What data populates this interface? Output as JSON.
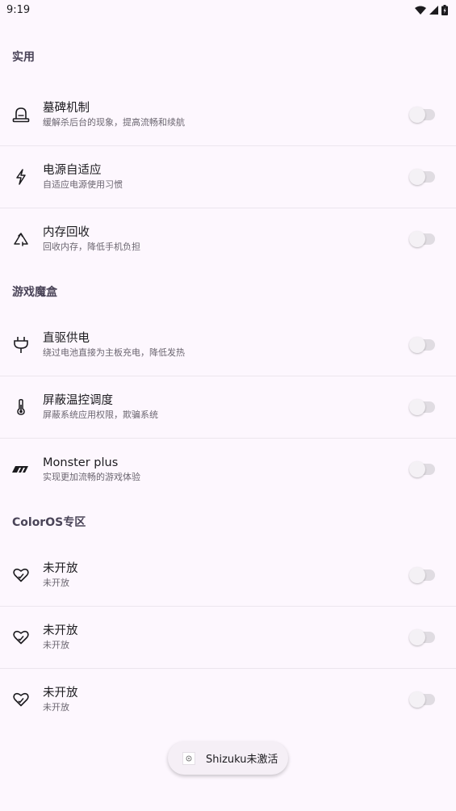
{
  "status_bar": {
    "time": "9:19"
  },
  "sections": [
    {
      "title": "实用",
      "items": [
        {
          "icon": "tombstone-icon",
          "title": "墓碑机制",
          "subtitle": "缓解杀后台的现象，提高流畅和续航",
          "enabled": false
        },
        {
          "icon": "lightning-icon",
          "title": "电源自适应",
          "subtitle": "自适应电源使用习惯",
          "enabled": false
        },
        {
          "icon": "recycle-icon",
          "title": "内存回收",
          "subtitle": "回收内存，降低手机负担",
          "enabled": false
        }
      ]
    },
    {
      "title": "游戏魔盒",
      "items": [
        {
          "icon": "plug-icon",
          "title": "直驱供电",
          "subtitle": "绕过电池直接为主板充电，降低发热",
          "enabled": false
        },
        {
          "icon": "thermometer-icon",
          "title": "屏蔽温控调度",
          "subtitle": "屏蔽系统应用权限，欺骗系统",
          "enabled": false
        },
        {
          "icon": "monster-logo-icon",
          "title": "Monster plus",
          "subtitle": "实现更加流畅的游戏体验",
          "enabled": false
        }
      ]
    },
    {
      "title": "ColorOS专区",
      "items": [
        {
          "icon": "heart-check-icon",
          "title": "未开放",
          "subtitle": "未开放",
          "enabled": false
        },
        {
          "icon": "heart-check-icon",
          "title": "未开放",
          "subtitle": "未开放",
          "enabled": false
        },
        {
          "icon": "heart-check-icon",
          "title": "未开放",
          "subtitle": "未开放",
          "enabled": false
        }
      ]
    }
  ],
  "snackbar": {
    "text": "Shizuku未激活",
    "icon": "app-icon"
  }
}
